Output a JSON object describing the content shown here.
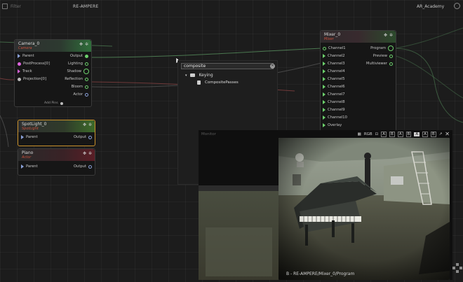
{
  "topbar": {
    "filter_placeholder": "Filter",
    "project_title": "RE-AMPERE",
    "workspace": "AR_Academy"
  },
  "nodes": {
    "camera": {
      "name": "Camera_0",
      "type": "Camera",
      "inputs": [
        "Parent",
        "PostProcess[0]",
        "Track",
        "Projection[0]"
      ],
      "outputs": [
        "Output",
        "Lighting",
        "Shadow",
        "Reflection",
        "Bloom",
        "Actor"
      ],
      "add_pins": "Add Pins"
    },
    "spotlight": {
      "name": "SpotLight_0",
      "type": "SpotLight",
      "inputs": [
        "Parent"
      ],
      "outputs": [
        "Output"
      ]
    },
    "piano": {
      "name": "Piano",
      "type": "Actor",
      "inputs": [
        "Parent"
      ],
      "outputs": [
        "Output"
      ]
    },
    "mixer": {
      "name": "Mixer_0",
      "type": "Mixer",
      "inputs": [
        "Channel1",
        "Channel2",
        "Channel3",
        "Channel4",
        "Channel5",
        "Channel6",
        "Channel7",
        "Channel8",
        "Channel9",
        "Channel10",
        "Overlay"
      ],
      "outputs": [
        "Program",
        "Preview",
        "Multiviewer"
      ]
    }
  },
  "search_popup": {
    "query": "composite",
    "category": "Keying",
    "result": "CompositePasses"
  },
  "monitor": {
    "label": "Monitor",
    "toolbar": [
      "RGB",
      "A",
      "B",
      "A",
      "B",
      "A",
      "A",
      "B"
    ],
    "caption": "B - RE-AMPERE/Mixer_0/Program"
  },
  "colors": {
    "camera_header": "#2f6e3a",
    "spotlight_header": "#3d6b2a",
    "piano_header": "#5a1e26",
    "mixer_header": "#3c2a2e",
    "selected_border": "#c8902a"
  }
}
